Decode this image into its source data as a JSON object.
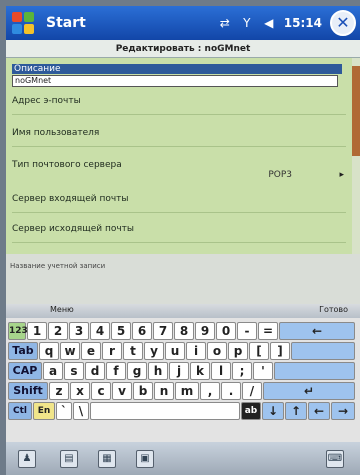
{
  "titlebar": {
    "title": "Start",
    "clock": "15:14",
    "close_label": "✕",
    "tray_icons": [
      "connectivity-icon",
      "signal-icon",
      "speaker-icon"
    ]
  },
  "dialog": {
    "header": "Редактировать : noGMnet"
  },
  "form": {
    "fields": [
      {
        "label": "Описание",
        "value": "noGMnet",
        "selected": true
      },
      {
        "label": "Адрес э-почты",
        "value": ""
      },
      {
        "label": "Имя пользователя",
        "value": ""
      },
      {
        "label": "Тип почтового сервера",
        "value": "POP3"
      },
      {
        "label": "Сервер входящей почты",
        "value": ""
      },
      {
        "label": "Сервер исходящей почты",
        "value": ""
      }
    ]
  },
  "hint": "Название учетной записи",
  "menubar": {
    "left": "Меню",
    "right": "Готово"
  },
  "keyboard": {
    "row1": [
      "123",
      "1",
      "2",
      "3",
      "4",
      "5",
      "6",
      "7",
      "8",
      "9",
      "0",
      "-",
      "=",
      "←"
    ],
    "row2": [
      "Tab",
      "q",
      "w",
      "e",
      "r",
      "t",
      "y",
      "u",
      "i",
      "o",
      "p",
      "[",
      "]"
    ],
    "row3": [
      "CAP",
      "a",
      "s",
      "d",
      "f",
      "g",
      "h",
      "j",
      "k",
      "l",
      ";",
      "'"
    ],
    "row4": [
      "Shift",
      "z",
      "x",
      "c",
      "v",
      "b",
      "n",
      "m",
      ",",
      ".",
      "/",
      "↵"
    ],
    "row5": [
      "Ctl",
      "En",
      "`",
      "\\",
      "",
      "ab",
      "↓",
      "↑",
      "←",
      "→"
    ]
  },
  "colors": {
    "titlebar": "#1a56c4",
    "form_bg": "#c9dfa9",
    "selected_label": "#2e5a9a",
    "modifier_key": "#8fb6e5"
  }
}
